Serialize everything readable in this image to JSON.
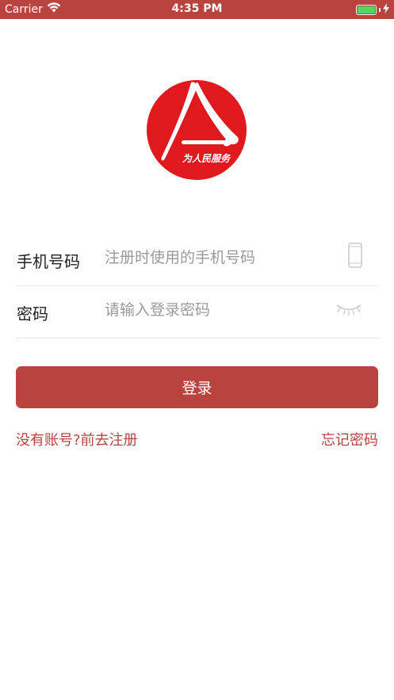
{
  "status_bar": {
    "carrier": "Carrier",
    "time": "4:35 PM",
    "battery_level": 1.0,
    "colors": {
      "background": "#b8433f",
      "battery": "#4cd964"
    }
  },
  "logo": {
    "icon": "people-service-logo",
    "caption": "为人民服务",
    "colors": {
      "circle": "#e0191f",
      "stroke": "#ffffff"
    }
  },
  "form": {
    "phone": {
      "label": "手机号码",
      "value": "",
      "placeholder": "注册时使用的手机号码",
      "icon": "phone-icon"
    },
    "password": {
      "label": "密码",
      "value": "",
      "placeholder": "请输入登录密码",
      "icon": "eye-closed-icon"
    }
  },
  "login_button": {
    "label": "登录"
  },
  "links": {
    "register": "没有账号?前去注册",
    "forgot": "忘记密码"
  },
  "theme": {
    "accent": "#b8433f",
    "divider": "#e6e6e6",
    "placeholder": "#9a9a9a"
  }
}
